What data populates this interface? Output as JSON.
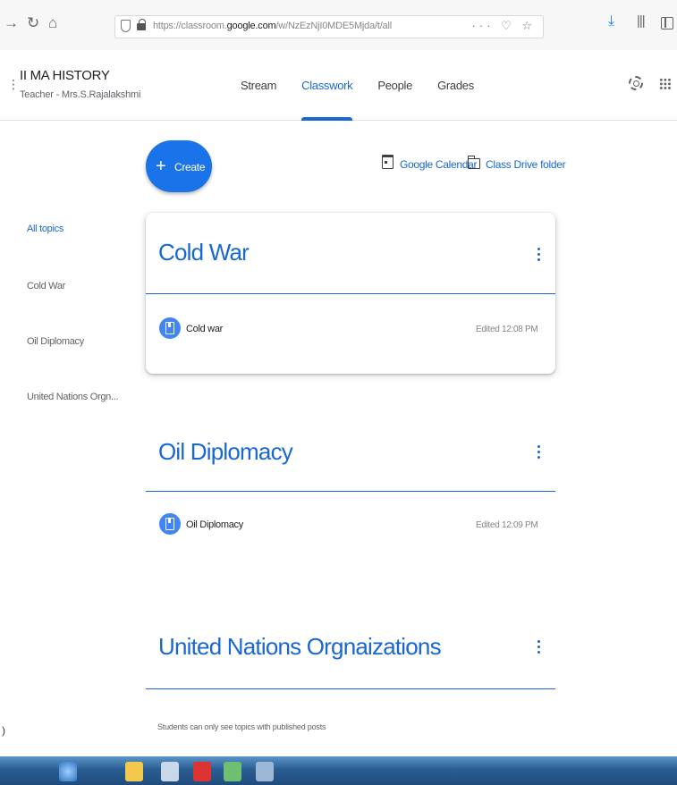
{
  "browser": {
    "url_prefix": "https://classroom.",
    "url_domain": "google.com",
    "url_path": "/w/NzEzNjI0MDE5Mjda/t/all",
    "url_actions": "··· ♡ ☆"
  },
  "header": {
    "class_name": "II MA HISTORY",
    "teacher": "Teacher - Mrs.S.Rajalakshmi",
    "tabs": [
      "Stream",
      "Classwork",
      "People",
      "Grades"
    ],
    "active_tab": "Classwork"
  },
  "toolbar": {
    "create_label": "Create",
    "calendar_link": "Google Calendar",
    "drive_link": "Class Drive folder"
  },
  "sidebar": {
    "topics": [
      "All topics",
      "Cold War",
      "Oil Diplomacy",
      "United Nations Orgn..."
    ]
  },
  "topics": [
    {
      "title": "Cold War",
      "items": [
        {
          "title": "Cold war",
          "meta": "Edited 12:08 PM"
        }
      ]
    },
    {
      "title": "Oil Diplomacy",
      "items": [
        {
          "title": "Oil Diplomacy",
          "meta": "Edited 12:09 PM"
        }
      ]
    },
    {
      "title": "United Nations Orgnaizations",
      "items": []
    }
  ],
  "footer": {
    "note": "Students can only see topics with published posts"
  },
  "colors": {
    "accent": "#1967d2",
    "create_button": "#1a73e8",
    "assignment_icon": "#4285f4"
  }
}
